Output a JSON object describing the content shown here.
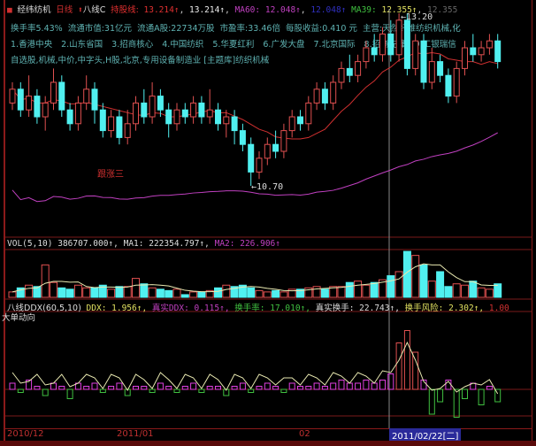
{
  "header": {
    "stock_name": "经纬纺机",
    "period": "日线",
    "indicator": "八线C",
    "hold_label": "持股线:",
    "hold_val1": "13.214↑",
    "hold_val2": "13.214↑",
    "ma60_label": "MA60:",
    "ma60_val1": "12.048↑",
    "ma60_val2": "12.048↑",
    "ma39_label": "MA39:",
    "ma39_val1": "12.355↑",
    "ma39_val2": "12.355"
  },
  "info": {
    "turnover": "换手率5.43%",
    "float_value": "流通市值:31亿元",
    "float_a": "流通A股:22734万股",
    "pe": "市盈率:33.46倍",
    "eps": "每股收益:0.410 元",
    "business": "主营:天然纤维纺织机械,化"
  },
  "holders": [
    "1.香港中央",
    "2.山东省国",
    "3.招商核心",
    "4.中国纺织",
    "5.华夏红利",
    "6.广发大盘",
    "7.北京国际",
    "8.招商先锋",
    "9.工银瑞信"
  ],
  "tags": "自选股,机械,中价,中字头,H股,北京,专用设备制造业  [主题库]纺织机械",
  "annotations": {
    "high": "13.20",
    "low": "10.70",
    "follow": "跟涨三"
  },
  "vol": {
    "label": "VOL(5,10)",
    "vol_val": "386707.000↑,",
    "ma1_label": "MA1:",
    "ma1_val": "222354.797↑,",
    "ma2_label": "MA2:",
    "ma2_val": "226.906↑"
  },
  "ddx": {
    "label": "八线DDX(60,5,10)",
    "ddx": "DDX: 1.956↑,",
    "real_ddx": "真实DDX: 0.115↑,",
    "turn": "换手率: 17.010↑,",
    "real_turn": "真实换手: 22.743↑,",
    "risk": "换手风险: 2.302↑,",
    "v1": "1.00",
    "sub": "大单动向"
  },
  "xaxis": {
    "labels": [
      "2010/12",
      "2011/01",
      "02"
    ],
    "cursor_date": "2011/02/22[二]"
  },
  "colors": {
    "up": "#e05050",
    "down": "#50f0f0",
    "ma_white": "#e8e8b0",
    "ma_purple": "#c040c0",
    "ma_red": "#d03030",
    "ma_green": "#40a040"
  },
  "candles": [
    [
      11.9,
      12.1,
      12.2,
      11.8
    ],
    [
      12.1,
      11.8,
      12.2,
      11.7
    ],
    [
      11.8,
      12.0,
      12.3,
      11.7
    ],
    [
      12.0,
      11.7,
      12.1,
      11.6
    ],
    [
      11.7,
      11.9,
      12.0,
      11.5
    ],
    [
      11.9,
      12.2,
      12.4,
      11.8
    ],
    [
      12.2,
      11.8,
      12.3,
      11.7
    ],
    [
      11.8,
      11.6,
      11.9,
      11.5
    ],
    [
      11.6,
      11.9,
      12.0,
      11.5
    ],
    [
      11.9,
      12.1,
      12.3,
      11.8
    ],
    [
      12.1,
      11.8,
      12.2,
      11.6
    ],
    [
      11.8,
      11.5,
      11.9,
      11.4
    ],
    [
      11.5,
      11.7,
      11.8,
      11.4
    ],
    [
      11.7,
      11.4,
      11.8,
      11.3
    ],
    [
      11.4,
      11.6,
      11.8,
      11.3
    ],
    [
      11.6,
      11.9,
      12.0,
      11.5
    ],
    [
      11.9,
      11.7,
      12.1,
      11.6
    ],
    [
      11.7,
      12.0,
      12.2,
      11.6
    ],
    [
      12.0,
      11.8,
      12.1,
      11.7
    ],
    [
      11.8,
      11.6,
      11.9,
      11.4
    ],
    [
      11.6,
      11.8,
      11.9,
      11.5
    ],
    [
      11.8,
      11.7,
      11.9,
      11.6
    ],
    [
      11.7,
      11.9,
      12.0,
      11.6
    ],
    [
      11.9,
      11.7,
      12.0,
      11.6
    ],
    [
      11.7,
      11.8,
      12.1,
      11.6
    ],
    [
      11.8,
      11.6,
      11.9,
      11.5
    ],
    [
      11.6,
      11.7,
      11.8,
      11.4
    ],
    [
      11.7,
      11.5,
      11.8,
      11.3
    ],
    [
      11.5,
      11.3,
      11.6,
      11.2
    ],
    [
      11.3,
      10.9,
      11.4,
      10.7
    ],
    [
      10.9,
      11.1,
      11.2,
      10.8
    ],
    [
      11.1,
      11.3,
      11.4,
      11.0
    ],
    [
      11.3,
      11.2,
      11.5,
      11.1
    ],
    [
      11.2,
      11.5,
      11.6,
      11.1
    ],
    [
      11.5,
      11.7,
      11.8,
      11.4
    ],
    [
      11.7,
      11.6,
      11.8,
      11.5
    ],
    [
      11.6,
      11.9,
      12.0,
      11.5
    ],
    [
      11.9,
      12.1,
      12.2,
      11.8
    ],
    [
      12.1,
      11.9,
      12.2,
      11.8
    ],
    [
      11.9,
      12.2,
      12.3,
      11.8
    ],
    [
      12.2,
      12.4,
      12.5,
      12.1
    ],
    [
      12.4,
      12.3,
      12.6,
      12.2
    ],
    [
      12.3,
      12.5,
      12.6,
      12.2
    ],
    [
      12.5,
      12.7,
      12.8,
      12.4
    ],
    [
      12.7,
      12.6,
      12.9,
      12.5
    ],
    [
      12.6,
      12.9,
      13.0,
      12.5
    ],
    [
      12.9,
      12.6,
      13.1,
      12.5
    ],
    [
      12.6,
      13.1,
      13.2,
      12.5
    ],
    [
      13.1,
      12.4,
      13.2,
      12.3
    ],
    [
      12.4,
      12.8,
      12.9,
      12.3
    ],
    [
      12.8,
      12.2,
      12.9,
      12.1
    ],
    [
      12.2,
      12.5,
      12.7,
      12.1
    ],
    [
      12.5,
      12.3,
      12.6,
      12.2
    ],
    [
      12.3,
      12.0,
      12.4,
      11.9
    ],
    [
      12.0,
      12.4,
      12.5,
      11.9
    ],
    [
      12.4,
      12.7,
      12.8,
      12.3
    ],
    [
      12.7,
      12.6,
      12.9,
      12.5
    ],
    [
      12.6,
      12.7,
      12.8,
      12.5
    ],
    [
      12.7,
      12.8,
      12.9,
      12.6
    ],
    [
      12.8,
      12.5,
      12.9,
      12.4
    ]
  ],
  "volume": [
    20,
    35,
    45,
    40,
    120,
    55,
    35,
    30,
    45,
    35,
    35,
    45,
    30,
    40,
    40,
    70,
    50,
    35,
    30,
    25,
    30,
    10,
    20,
    20,
    25,
    35,
    45,
    40,
    45,
    35,
    25,
    20,
    25,
    20,
    30,
    30,
    35,
    40,
    30,
    40,
    40,
    55,
    60,
    45,
    55,
    65,
    80,
    95,
    170,
    155,
    120,
    60,
    95,
    40,
    50,
    45,
    60,
    35,
    30,
    50
  ],
  "ddx_values": [
    0.2,
    -0.1,
    0.3,
    0.1,
    -0.2,
    0.2,
    0.1,
    -0.3,
    0.2,
    0.1,
    0.2,
    -0.1,
    0.1,
    0.2,
    -0.2,
    0.1,
    0.1,
    -0.1,
    0.2,
    0.1,
    -0.1,
    0.1,
    0.2,
    -0.1,
    0.1,
    0.1,
    -0.2,
    0.1,
    0.2,
    -0.1,
    0.1,
    0.2,
    0.1,
    -0.1,
    0.2,
    0.1,
    0.1,
    0.2,
    0.1,
    0.2,
    0.3,
    0.2,
    0.2,
    0.3,
    0.2,
    0.3,
    0.5,
    1.5,
    1.9,
    1.2,
    0.3,
    -0.8,
    -0.4,
    0.3,
    -0.9,
    -0.3,
    0.2,
    -0.5,
    0.1,
    -0.4
  ]
}
